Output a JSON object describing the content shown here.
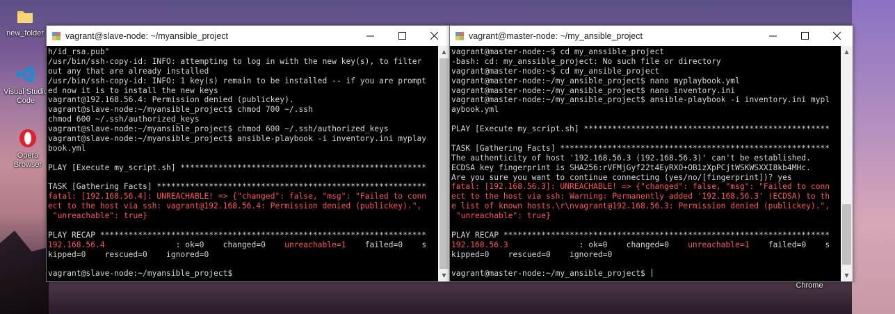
{
  "desktop": {
    "icons": [
      {
        "label": "new_folder",
        "icon": "folder-icon"
      },
      {
        "label": "Visual Studio Code",
        "icon": "vscode-icon"
      },
      {
        "label": "Opera Browser",
        "icon": "opera-icon"
      },
      {
        "label": "Chrome",
        "icon": "chrome-icon"
      }
    ]
  },
  "windows": [
    {
      "title": "vagrant@slave-node: ~/myansible_project",
      "lines": [
        {
          "text": "h/id_rsa.pub\"",
          "color": "normal"
        },
        {
          "text": "/usr/bin/ssh-copy-id: INFO: attempting to log in with the new key(s), to filter",
          "color": "normal"
        },
        {
          "text": "out any that are already installed",
          "color": "normal"
        },
        {
          "text": "/usr/bin/ssh-copy-id: INFO: 1 key(s) remain to be installed -- if you are prompt",
          "color": "normal"
        },
        {
          "text": "ed now it is to install the new keys",
          "color": "normal"
        },
        {
          "text": "vagrant@192.168.56.4: Permission denied (publickey).",
          "color": "normal"
        },
        {
          "text": "vagrant@slave-node:~/myansible_project$ chmod 700 ~/.ssh",
          "color": "normal"
        },
        {
          "text": "chmod 600 ~/.ssh/authorized_keys",
          "color": "normal"
        },
        {
          "text": "vagrant@slave-node:~/myansible_project$ chmod 600 ~/.ssh/authorized_keys",
          "color": "normal"
        },
        {
          "text": "vagrant@slave-node:~/myansible_project$ ansible-playbook -i inventory.ini myplay",
          "color": "normal"
        },
        {
          "text": "book.yml",
          "color": "normal"
        },
        {
          "text": "",
          "color": "normal"
        },
        {
          "text": "PLAY [Execute my_script.sh] ****************************************************",
          "color": "normal"
        },
        {
          "text": "",
          "color": "normal"
        },
        {
          "text": "TASK [Gathering Facts] *********************************************************",
          "color": "normal"
        },
        {
          "text": "fatal: [192.168.56.4]: UNREACHABLE! => {\"changed\": false, \"msg\": \"Failed to conn",
          "color": "red"
        },
        {
          "text": "ect to the host via ssh: vagrant@192.168.56.4: Permission denied (publickey).\",",
          "color": "red"
        },
        {
          "text": " \"unreachable\": true}",
          "color": "red"
        },
        {
          "text": "",
          "color": "normal"
        },
        {
          "text": "PLAY RECAP *********************************************************************",
          "color": "normal"
        },
        {
          "segments": [
            {
              "text": "192.168.56.4",
              "color": "red"
            },
            {
              "text": "               : ok=0    changed=0    ",
              "color": "normal"
            },
            {
              "text": "unreachable=1",
              "color": "red"
            },
            {
              "text": "    failed=0    s",
              "color": "normal"
            }
          ]
        },
        {
          "text": "kipped=0    rescued=0    ignored=0",
          "color": "normal"
        },
        {
          "text": "",
          "color": "normal"
        },
        {
          "text": "vagrant@slave-node:~/myansible_project$ ",
          "color": "normal"
        }
      ]
    },
    {
      "title": "vagrant@master-node: ~/my_ansible_project",
      "lines": [
        {
          "text": "vagrant@master-node:~$ cd my_anssible_project",
          "color": "normal"
        },
        {
          "text": "-bash: cd: my_anssible_project: No such file or directory",
          "color": "normal"
        },
        {
          "text": "vagrant@master-node:~$ cd my_ansible_project",
          "color": "normal"
        },
        {
          "text": "vagrant@master-node:~/my_ansible_project$ nano myplaybook.yml",
          "color": "normal"
        },
        {
          "text": "vagrant@master-node:~/my_ansible_project$ nano inventory.ini",
          "color": "normal"
        },
        {
          "text": "vagrant@master-node:~/my_ansible_project$ ansible-playbook -i inventory.ini mypl",
          "color": "normal"
        },
        {
          "text": "aybook.yml",
          "color": "normal"
        },
        {
          "text": "",
          "color": "normal"
        },
        {
          "text": "PLAY [Execute my_script.sh] ****************************************************",
          "color": "normal"
        },
        {
          "text": "",
          "color": "normal"
        },
        {
          "text": "TASK [Gathering Facts] *********************************************************",
          "color": "normal"
        },
        {
          "text": "The authenticity of host '192.168.56.3 (192.168.56.3)' can't be established.",
          "color": "normal"
        },
        {
          "text": "ECDSA key fingerprint is SHA256:rVFMjGyf22t4EyRXO+OB1zXpPCjtWSKWSXXI8kb4MHc.",
          "color": "normal"
        },
        {
          "text": "Are you sure you want to continue connecting (yes/no/[fingerprint])? yes",
          "color": "normal"
        },
        {
          "text": "fatal: [192.168.56.3]: UNREACHABLE! => {\"changed\": false, \"msg\": \"Failed to conn",
          "color": "red"
        },
        {
          "text": "ect to the host via ssh: Warning: Permanently added '192.168.56.3' (ECDSA) to th",
          "color": "red"
        },
        {
          "text": "e list of known hosts.\\r\\nvagrant@192.168.56.3: Permission denied (publickey).\",",
          "color": "red"
        },
        {
          "text": " \"unreachable\": true}",
          "color": "red"
        },
        {
          "text": "",
          "color": "normal"
        },
        {
          "text": "PLAY RECAP *********************************************************************",
          "color": "normal"
        },
        {
          "segments": [
            {
              "text": "192.168.56.3",
              "color": "red"
            },
            {
              "text": "               : ok=0    changed=0    ",
              "color": "normal"
            },
            {
              "text": "unreachable=1",
              "color": "red"
            },
            {
              "text": "    failed=0    s",
              "color": "normal"
            }
          ]
        },
        {
          "text": "kipped=0    rescued=0    ignored=0",
          "color": "normal"
        },
        {
          "text": "",
          "color": "normal"
        },
        {
          "text": "vagrant@master-node:~/my_ansible_project$ ",
          "color": "normal",
          "cursor": true
        }
      ]
    }
  ],
  "colors": {
    "terminal_bg": "#000000",
    "terminal_text": "#d6d6d6",
    "error_text": "#ff5555",
    "titlebar_bg": "#ffffff"
  }
}
